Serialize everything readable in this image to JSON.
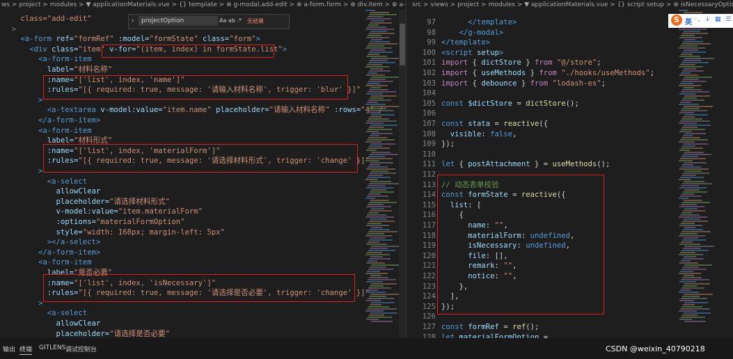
{
  "left_pane": {
    "breadcrumb": "ws > project > modules > ▼ applicationMaterials.vue > {} template > ⊕ g-modal.add-edit > ⊕ a-form.form > ⊕ div.item > ⊕ a-form-item > ⊕ a-select"
  },
  "right_pane": {
    "breadcrumb": "src > views > project > modules > ▼ applicationMaterials.vue > {} script setup > ⊕ isNecessaryOption"
  },
  "find_widget": {
    "query": "projectOption",
    "options": "Aa ab .*",
    "result": "无结果"
  },
  "ime_toolbar": {
    "logo": "S",
    "mode": "英",
    "icons": "·, ↓ ▦ ☰"
  },
  "status_bar": {
    "tabs": [
      "输出",
      "终端",
      "GITLENS",
      "调试控制台"
    ],
    "active_tab": 1,
    "watermark": "CSDN @weixin_40790218"
  },
  "left_code": [
    {
      "segs": [
        [
          "    ",
          "pun"
        ],
        [
          "class=\"add-edit\"",
          "str"
        ]
      ]
    },
    {
      "segs": [
        [
          "  >",
          "dim"
        ]
      ]
    },
    {
      "segs": [
        [
          "    ",
          "pun"
        ],
        [
          "<a-form ",
          "tag"
        ],
        [
          "ref=",
          "attr"
        ],
        [
          "\"formRef\" ",
          "str"
        ],
        [
          ":model=",
          "attr"
        ],
        [
          "\"formState\" ",
          "str"
        ],
        [
          "class=",
          "attr"
        ],
        [
          "\"form\"",
          "str"
        ],
        [
          ">",
          "tag"
        ]
      ]
    },
    {
      "segs": [
        [
          "      ",
          "pun"
        ],
        [
          "<div ",
          "tag"
        ],
        [
          "class=",
          "attr"
        ],
        [
          "\"item\" ",
          "str"
        ],
        [
          "v-for=",
          "attr"
        ],
        [
          "\"(item, index) in formState.list\"",
          "str"
        ],
        [
          ">",
          "tag"
        ]
      ]
    },
    {
      "segs": [
        [
          "        ",
          "pun"
        ],
        [
          "<a-form-item",
          "tag"
        ]
      ]
    },
    {
      "segs": [
        [
          "          ",
          "pun"
        ],
        [
          "label=",
          "attr"
        ],
        [
          "\"材料名称\"",
          "str"
        ]
      ]
    },
    {
      "segs": [
        [
          "          ",
          "pun"
        ],
        [
          ":name=",
          "attr"
        ],
        [
          "\"['list', index, 'name']\"",
          "str"
        ]
      ]
    },
    {
      "segs": [
        [
          "          ",
          "pun"
        ],
        [
          ":rules=",
          "attr"
        ],
        [
          "\"[{ required: true, message: '请输入材料名称', trigger: 'blur' }]\"",
          "str"
        ]
      ]
    },
    {
      "segs": [
        [
          "        >",
          "tag"
        ]
      ]
    },
    {
      "segs": [
        [
          "          ",
          "pun"
        ],
        [
          "<a-textarea ",
          "tag"
        ],
        [
          "v-model:value=",
          "attr"
        ],
        [
          "\"item.name\" ",
          "str"
        ],
        [
          "placeholder=",
          "attr"
        ],
        [
          "\"请输入材料名称\" ",
          "str"
        ],
        [
          ":rows=",
          "attr"
        ],
        [
          "\"4\" /",
          "str"
        ]
      ]
    },
    {
      "segs": [
        [
          "        ",
          "pun"
        ],
        [
          "</a-form-item>",
          "tag"
        ]
      ]
    },
    {
      "segs": [
        [
          "        ",
          "pun"
        ],
        [
          "<a-form-item",
          "tag"
        ]
      ]
    },
    {
      "segs": [
        [
          "          ",
          "pun"
        ],
        [
          "label=",
          "attr"
        ],
        [
          "\"材料形式\"",
          "str"
        ]
      ]
    },
    {
      "segs": [
        [
          "          ",
          "pun"
        ],
        [
          ":name=",
          "attr"
        ],
        [
          "\"['list', index, 'materialForm']\"",
          "str"
        ]
      ]
    },
    {
      "segs": [
        [
          "          ",
          "pun"
        ],
        [
          ":rules=",
          "attr"
        ],
        [
          "\"[{ required: true, message: '请选择材料形式', trigger: 'change' }]\"",
          "str"
        ]
      ]
    },
    {
      "segs": [
        [
          "        >",
          "tag"
        ]
      ]
    },
    {
      "segs": [
        [
          "          ",
          "pun"
        ],
        [
          "<a-select",
          "tag"
        ]
      ]
    },
    {
      "segs": [
        [
          "            ",
          "pun"
        ],
        [
          "allowClear",
          "attr"
        ]
      ]
    },
    {
      "segs": [
        [
          "            ",
          "pun"
        ],
        [
          "placeholder=",
          "attr"
        ],
        [
          "\"请选择材料形式\"",
          "str"
        ]
      ]
    },
    {
      "segs": [
        [
          "            ",
          "pun"
        ],
        [
          "v-model:value=",
          "attr"
        ],
        [
          "\"item.materialForm\"",
          "str"
        ]
      ]
    },
    {
      "segs": [
        [
          "            ",
          "pun"
        ],
        [
          ":options=",
          "attr"
        ],
        [
          "\"materialFormOption\"",
          "str"
        ]
      ]
    },
    {
      "segs": [
        [
          "            ",
          "pun"
        ],
        [
          "style=",
          "attr"
        ],
        [
          "\"width: 168px; margin-left: 5px\"",
          "str"
        ]
      ]
    },
    {
      "segs": [
        [
          "          ",
          "pun"
        ],
        [
          "></a-select>",
          "tag"
        ]
      ]
    },
    {
      "segs": [
        [
          "        ",
          "pun"
        ],
        [
          "</a-form-item>",
          "tag"
        ]
      ]
    },
    {
      "segs": [
        [
          "        ",
          "pun"
        ],
        [
          "<a-form-item",
          "tag"
        ]
      ]
    },
    {
      "segs": [
        [
          "          ",
          "pun"
        ],
        [
          "label=",
          "attr"
        ],
        [
          "\"是否必要\"",
          "str"
        ]
      ]
    },
    {
      "segs": [
        [
          "          ",
          "pun"
        ],
        [
          ":name=",
          "attr"
        ],
        [
          "\"['list', index, 'isNecessary']\"",
          "str"
        ]
      ]
    },
    {
      "segs": [
        [
          "          ",
          "pun"
        ],
        [
          ":rules=",
          "attr"
        ],
        [
          "\"[{ required: true, message: '请选择是否必要', trigger: 'change' }]\"",
          "str"
        ]
      ]
    },
    {
      "segs": [
        [
          "        >",
          "tag"
        ]
      ]
    },
    {
      "segs": [
        [
          "          ",
          "pun"
        ],
        [
          "<a-select",
          "tag"
        ]
      ]
    },
    {
      "segs": [
        [
          "            ",
          "pun"
        ],
        [
          "allowClear",
          "attr"
        ]
      ]
    },
    {
      "segs": [
        [
          "            ",
          "pun"
        ],
        [
          "placeholder=",
          "attr"
        ],
        [
          "\"请选择是否必要\"",
          "str"
        ]
      ]
    },
    {
      "segs": [
        [
          "            ",
          "pun"
        ],
        [
          "v-model:value=",
          "attr"
        ],
        [
          "\"item.isNecessary\"",
          "str"
        ]
      ]
    }
  ],
  "right_code": [
    {
      "n": "97",
      "segs": [
        [
          "      ",
          "pun"
        ],
        [
          "</template>",
          "tag"
        ]
      ]
    },
    {
      "n": "98",
      "segs": [
        [
          "    ",
          "pun"
        ],
        [
          "</g-modal>",
          "tag"
        ]
      ]
    },
    {
      "n": "99",
      "segs": [
        [
          "</template>",
          "tag"
        ]
      ]
    },
    {
      "n": "100",
      "segs": [
        [
          "<script ",
          "tag"
        ],
        [
          "setup",
          "attr"
        ],
        [
          ">",
          "tag"
        ]
      ]
    },
    {
      "n": "101",
      "segs": [
        [
          "import ",
          "kw"
        ],
        [
          "{ ",
          "pun"
        ],
        [
          "dictStore",
          "var"
        ],
        [
          " } ",
          "pun"
        ],
        [
          "from ",
          "kw"
        ],
        [
          "\"@/store\"",
          "str"
        ],
        [
          ";",
          "pun"
        ]
      ]
    },
    {
      "n": "102",
      "segs": [
        [
          "import ",
          "kw"
        ],
        [
          "{ ",
          "pun"
        ],
        [
          "useMethods",
          "var"
        ],
        [
          " } ",
          "pun"
        ],
        [
          "from ",
          "kw"
        ],
        [
          "\"./hooks/useMethods\"",
          "str"
        ],
        [
          ";",
          "pun"
        ]
      ]
    },
    {
      "n": "103",
      "segs": [
        [
          "import ",
          "kw"
        ],
        [
          "{ ",
          "pun"
        ],
        [
          "debounce",
          "var"
        ],
        [
          " } ",
          "pun"
        ],
        [
          "from ",
          "kw"
        ],
        [
          "\"lodash-es\"",
          "str"
        ],
        [
          ";",
          "pun"
        ]
      ]
    },
    {
      "n": "104",
      "segs": []
    },
    {
      "n": "105",
      "segs": [
        [
          "const ",
          "blue"
        ],
        [
          "$dictStore",
          "var"
        ],
        [
          " = ",
          "pun"
        ],
        [
          "dictStore",
          "fn"
        ],
        [
          "();",
          "pun"
        ]
      ]
    },
    {
      "n": "106",
      "segs": []
    },
    {
      "n": "107",
      "segs": [
        [
          "const ",
          "blue"
        ],
        [
          "stata",
          "var"
        ],
        [
          " = ",
          "pun"
        ],
        [
          "reactive",
          "fn"
        ],
        [
          "({",
          "pun"
        ]
      ]
    },
    {
      "n": "108",
      "segs": [
        [
          "  visible",
          "var"
        ],
        [
          ": ",
          "pun"
        ],
        [
          "false",
          "blue"
        ],
        [
          ",",
          "pun"
        ]
      ]
    },
    {
      "n": "109",
      "segs": [
        [
          "});",
          "pun"
        ]
      ]
    },
    {
      "n": "110",
      "segs": []
    },
    {
      "n": "111",
      "segs": [
        [
          "let ",
          "blue"
        ],
        [
          "{ ",
          "pun"
        ],
        [
          "postAttachment",
          "var"
        ],
        [
          " } = ",
          "pun"
        ],
        [
          "useMethods",
          "fn"
        ],
        [
          "();",
          "pun"
        ]
      ]
    },
    {
      "n": "112",
      "segs": []
    },
    {
      "n": "113",
      "segs": [
        [
          "// 动态表单校验",
          "cmt"
        ]
      ]
    },
    {
      "n": "114",
      "segs": [
        [
          "const ",
          "blue"
        ],
        [
          "formState",
          "var"
        ],
        [
          " = ",
          "pun"
        ],
        [
          "reactive",
          "fn"
        ],
        [
          "({",
          "pun"
        ]
      ]
    },
    {
      "n": "115",
      "segs": [
        [
          "  list",
          "var"
        ],
        [
          ": [",
          "pun"
        ]
      ]
    },
    {
      "n": "116",
      "segs": [
        [
          "    {",
          "pun"
        ]
      ]
    },
    {
      "n": "117",
      "segs": [
        [
          "      name",
          "var"
        ],
        [
          ": ",
          "pun"
        ],
        [
          "\"\"",
          "str"
        ],
        [
          ",",
          "pun"
        ]
      ]
    },
    {
      "n": "118",
      "segs": [
        [
          "      materialForm",
          "var"
        ],
        [
          ": ",
          "pun"
        ],
        [
          "undefined",
          "blue"
        ],
        [
          ",",
          "pun"
        ]
      ]
    },
    {
      "n": "119",
      "segs": [
        [
          "      isNecessary",
          "var"
        ],
        [
          ": ",
          "pun"
        ],
        [
          "undefined",
          "blue"
        ],
        [
          ",",
          "pun"
        ]
      ]
    },
    {
      "n": "120",
      "segs": [
        [
          "      file",
          "var"
        ],
        [
          ": [],",
          "pun"
        ]
      ]
    },
    {
      "n": "121",
      "segs": [
        [
          "      remark",
          "var"
        ],
        [
          ": ",
          "pun"
        ],
        [
          "\"\"",
          "str"
        ],
        [
          ",",
          "pun"
        ]
      ]
    },
    {
      "n": "122",
      "segs": [
        [
          "      notice",
          "var"
        ],
        [
          ": ",
          "pun"
        ],
        [
          "\"\"",
          "str"
        ],
        [
          ",",
          "pun"
        ]
      ]
    },
    {
      "n": "123",
      "segs": [
        [
          "    },",
          "pun"
        ]
      ]
    },
    {
      "n": "124",
      "segs": [
        [
          "  ],",
          "pun"
        ]
      ]
    },
    {
      "n": "125",
      "segs": [
        [
          "});",
          "pun"
        ]
      ]
    },
    {
      "n": "126",
      "segs": []
    },
    {
      "n": "127",
      "segs": [
        [
          "const ",
          "blue"
        ],
        [
          "formRef",
          "var"
        ],
        [
          " = ",
          "pun"
        ],
        [
          "ref",
          "fn"
        ],
        [
          "();",
          "pun"
        ]
      ]
    },
    {
      "n": "128",
      "segs": [
        [
          "let ",
          "blue"
        ],
        [
          "materialFormOption",
          "var"
        ],
        [
          " =",
          "pun"
        ]
      ]
    }
  ]
}
